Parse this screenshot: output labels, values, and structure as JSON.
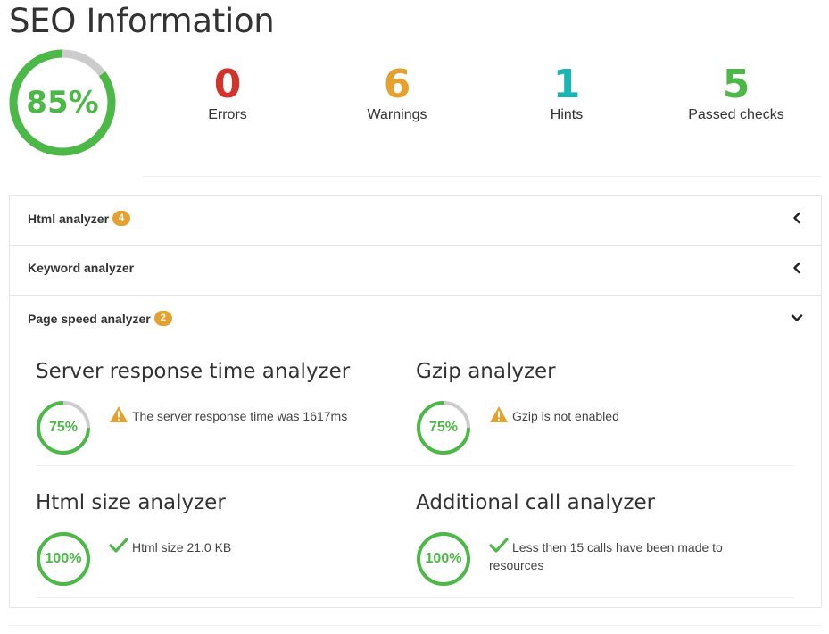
{
  "page": {
    "title": "SEO Information"
  },
  "overall": {
    "score_label": "85%",
    "score": 0.85,
    "color": "#4cb847"
  },
  "stats": [
    {
      "value": "0",
      "label": "Errors",
      "color": "#d0342c"
    },
    {
      "value": "6",
      "label": "Warnings",
      "color": "#e5a12f"
    },
    {
      "value": "1",
      "label": "Hints",
      "color": "#19b4b4"
    },
    {
      "value": "5",
      "label": "Passed checks",
      "color": "#4cb847"
    }
  ],
  "panels": [
    {
      "title": "Html analyzer",
      "badge": "4",
      "state": "collapsed"
    },
    {
      "title": "Keyword analyzer",
      "badge": "",
      "state": "collapsed"
    },
    {
      "title": "Page speed analyzer",
      "badge": "2",
      "state": "expanded"
    }
  ],
  "analyzers": [
    {
      "title": "Server response time analyzer",
      "score_label": "75%",
      "score": 0.75,
      "status": "warning",
      "icon": "warning-icon",
      "message": "The server response time was 1617ms"
    },
    {
      "title": "Gzip analyzer",
      "score_label": "75%",
      "score": 0.75,
      "status": "warning",
      "icon": "warning-icon",
      "message": "Gzip is not enabled"
    },
    {
      "title": "Html size analyzer",
      "score_label": "100%",
      "score": 1.0,
      "status": "passed",
      "icon": "check-icon",
      "message": "Html size 21.0 KB"
    },
    {
      "title": "Additional call analyzer",
      "score_label": "100%",
      "score": 1.0,
      "status": "passed",
      "icon": "check-icon",
      "message": "Less then 15 calls have been made to resources"
    }
  ],
  "colors": {
    "accent": "#4cb847",
    "warning": "#e5a12f",
    "track": "#cccccc",
    "badge": "#e5a12f"
  }
}
